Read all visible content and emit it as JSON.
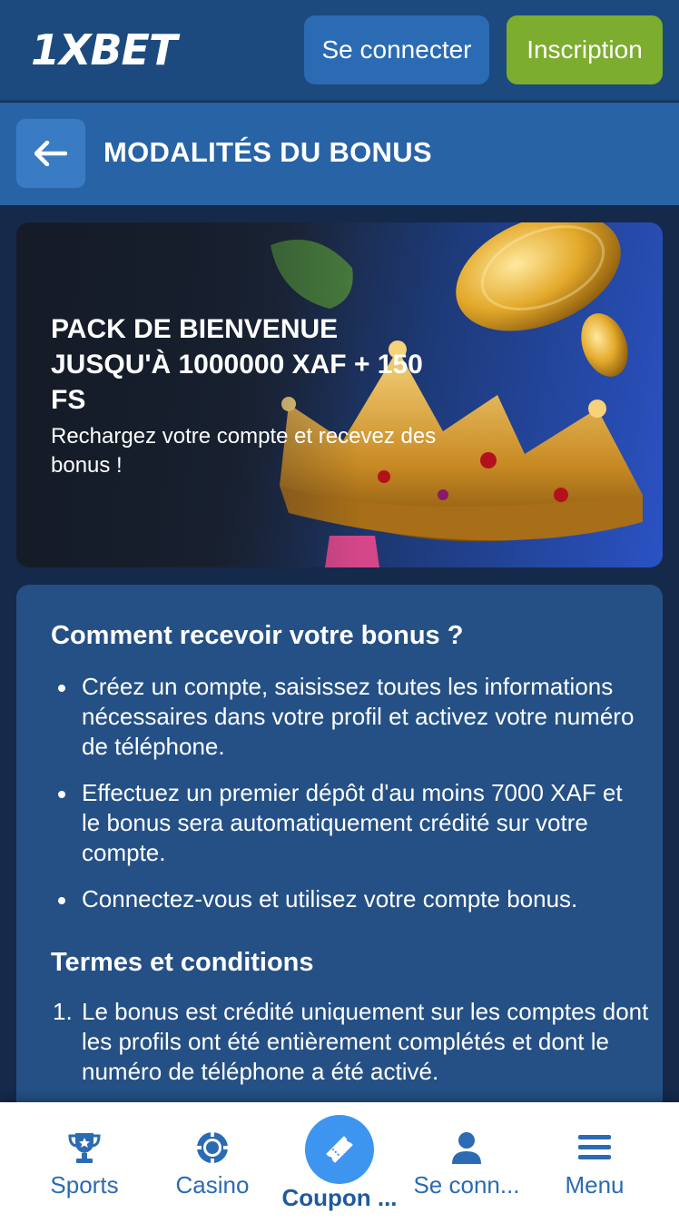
{
  "header": {
    "logo": {
      "prefix": "1X",
      "suffix": "BET"
    },
    "login_label": "Se connecter",
    "register_label": "Inscription"
  },
  "titlebar": {
    "title": "MODALITÉS DU BONUS"
  },
  "banner": {
    "title": "PACK DE BIENVENUE JUSQU'À 1000000 XAF + 150 FS",
    "subtitle": "Rechargez votre compte et recevez des bonus !"
  },
  "content": {
    "how_heading": "Comment recevoir votre bonus ?",
    "how_items": [
      "Créez un compte, saisissez toutes les informations nécessaires dans votre profil et activez votre numéro de téléphone.",
      "Effectuez un premier dépôt d'au moins 7000 XAF et le bonus sera automatiquement crédité sur votre compte.",
      "Connectez-vous et utilisez votre compte bonus."
    ],
    "terms_heading": "Termes et conditions",
    "terms_items": [
      {
        "num": "1.",
        "text": "Le bonus est crédité uniquement sur les comptes dont les profils ont été entièrement complétés et dont le numéro de téléphone a été activé."
      }
    ]
  },
  "bottom_nav": {
    "items": [
      {
        "label": "Sports",
        "icon": "trophy-icon"
      },
      {
        "label": "Casino",
        "icon": "casino-chip-icon"
      },
      {
        "label": "Coupon ...",
        "icon": "ticket-icon"
      },
      {
        "label": "Se conn...",
        "icon": "user-icon"
      },
      {
        "label": "Menu",
        "icon": "hamburger-icon"
      }
    ]
  },
  "colors": {
    "header_bg": "#1c4a7e",
    "titlebar_bg": "#2863a6",
    "page_bg": "#15294a",
    "card_bg": "#245085",
    "login_btn": "#2a6bb3",
    "register_btn": "#7cad2e",
    "nav_accent": "#2a6bb3",
    "coupon_circle": "#3d95ef"
  }
}
